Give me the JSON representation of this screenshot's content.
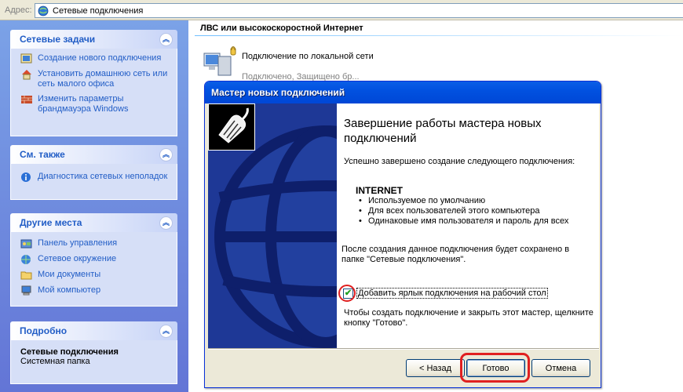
{
  "addressbar": {
    "label": "Адрес:",
    "value": "Сетевые подключения",
    "icon": "network-folder-icon"
  },
  "taskpane": {
    "network_tasks": {
      "title": "Сетевые задачи",
      "items": [
        {
          "label": "Создание нового подключения",
          "icon": "new-connection-icon"
        },
        {
          "label": "Установить домашнюю сеть или сеть малого офиса",
          "icon": "home-network-icon"
        },
        {
          "label": "Изменить параметры брандмауэра Windows",
          "icon": "firewall-icon"
        }
      ]
    },
    "see_also": {
      "title": "См. также",
      "items": [
        {
          "label": "Диагностика сетевых неполадок",
          "icon": "info-icon"
        }
      ]
    },
    "other_places": {
      "title": "Другие места",
      "items": [
        {
          "label": "Панель управления",
          "icon": "control-panel-icon"
        },
        {
          "label": "Сетевое окружение",
          "icon": "network-places-icon"
        },
        {
          "label": "Мои документы",
          "icon": "my-documents-icon"
        },
        {
          "label": "Мой компьютер",
          "icon": "my-computer-icon"
        }
      ]
    },
    "details": {
      "title": "Подробно",
      "name": "Сетевые подключения",
      "type": "Системная папка"
    }
  },
  "content": {
    "group_title": "ЛВС или высокоскоростной Интернет",
    "connection": {
      "name": "Подключение по локальной сети",
      "status": "Подключено, Защищено бр..."
    }
  },
  "wizard": {
    "title": "Мастер новых подключений",
    "heading": "Завершение работы мастера новых подключений",
    "success": "Успешно завершено создание следующего подключения:",
    "connection_name": "INTERNET",
    "bullets": [
      "Используемое по умолчанию",
      "Для всех пользователей этого компьютера",
      "Одинаковые имя пользователя и пароль для всех"
    ],
    "after_create": "После создания данное подключения будет сохранено в папке \"Сетевые подключения\".",
    "checkbox_label": "Добавить ярлык подключения на рабочий стол",
    "checkbox_checked": true,
    "finish_note": "Чтобы создать подключение и закрыть этот мастер, щелкните кнопку \"Готово\".",
    "buttons": {
      "back": "< Назад",
      "finish": "Готово",
      "cancel": "Отмена"
    },
    "colors": {
      "title_bar": "#0a5ee6",
      "highlight": "#e02020"
    }
  }
}
